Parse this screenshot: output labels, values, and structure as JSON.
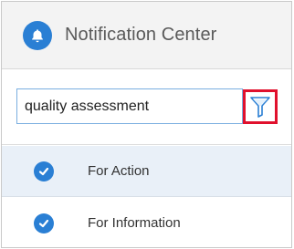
{
  "header": {
    "title": "Notification Center",
    "icon": "bell-icon",
    "accent_color": "#2a7fd4"
  },
  "search": {
    "value": "quality assessment",
    "filter_icon": "filter-icon",
    "highlight_color": "#e0102d"
  },
  "list": {
    "items": [
      {
        "label": "For Action",
        "icon": "check-badge-icon",
        "selected": true
      },
      {
        "label": "For Information",
        "icon": "check-badge-icon",
        "selected": false
      }
    ]
  }
}
